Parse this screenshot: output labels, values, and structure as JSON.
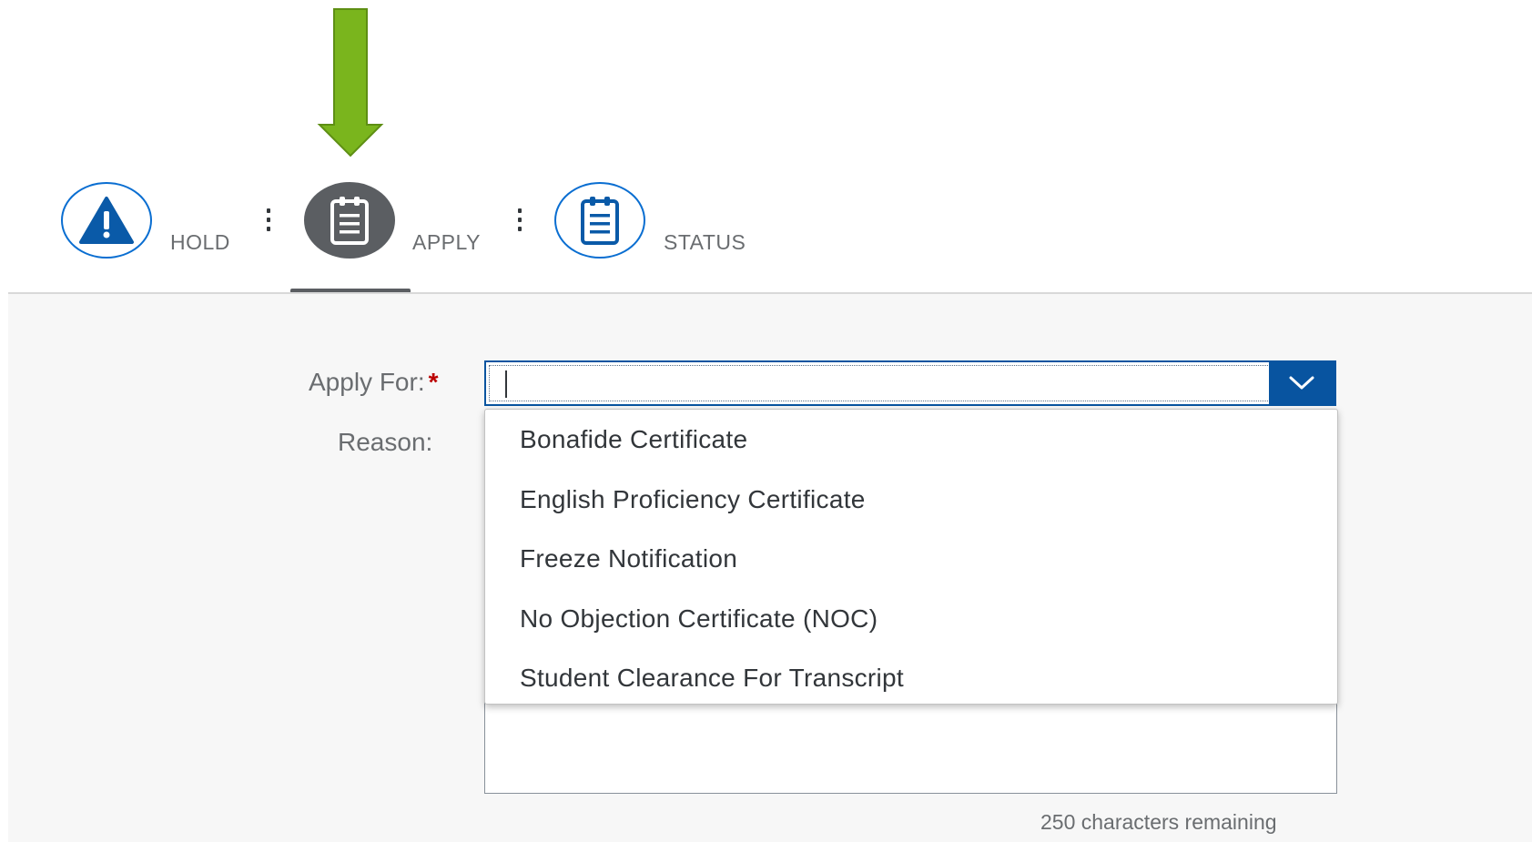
{
  "tabs": [
    {
      "label": "HOLD",
      "icon": "warning-icon",
      "active": false
    },
    {
      "label": "APPLY",
      "icon": "clipboard-icon",
      "active": true
    },
    {
      "label": "STATUS",
      "icon": "clipboard-icon",
      "active": false
    }
  ],
  "form": {
    "apply_for_label": "Apply For:",
    "required_mark": "*",
    "apply_for_value": "",
    "reason_label": "Reason:",
    "reason_value": "",
    "remaining_text": "250 characters remaining"
  },
  "dropdown": {
    "options": [
      "Bonafide Certificate",
      "English Proficiency Certificate",
      "Freeze Notification",
      "No Objection Certificate (NOC)",
      "Student Clearance For Transcript"
    ]
  },
  "annotation": {
    "icon": "green-down-arrow-icon",
    "color": "#7ab51d"
  },
  "colors": {
    "accent": "#0a6ed1",
    "button": "#0854a0",
    "active_tab": "#5b5e62",
    "required": "#bb0000"
  }
}
